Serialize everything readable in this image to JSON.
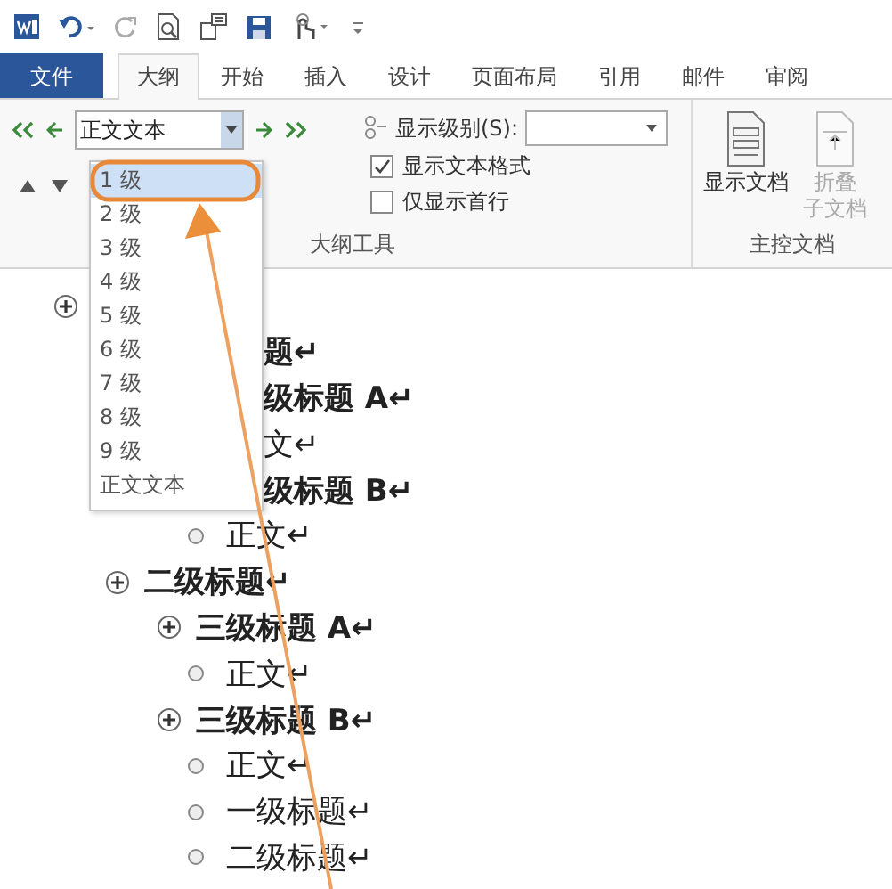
{
  "tabs": [
    {
      "label": "文件",
      "kind": "file",
      "selected": false
    },
    {
      "label": "大纲",
      "kind": "tab",
      "selected": true
    },
    {
      "label": "开始",
      "kind": "tab",
      "selected": false
    },
    {
      "label": "插入",
      "kind": "tab",
      "selected": false
    },
    {
      "label": "设计",
      "kind": "tab",
      "selected": false
    },
    {
      "label": "页面布局",
      "kind": "tab",
      "selected": false
    },
    {
      "label": "引用",
      "kind": "tab",
      "selected": false
    },
    {
      "label": "邮件",
      "kind": "tab",
      "selected": false
    },
    {
      "label": "审阅",
      "kind": "tab",
      "selected": false
    }
  ],
  "outline_tools": {
    "level_combo": {
      "value": "正文文本"
    },
    "show_level": {
      "label": "显示级别(S):"
    },
    "checkboxes": [
      {
        "label": "显示文本格式",
        "checked": true
      },
      {
        "label": "仅显示首行",
        "checked": false
      }
    ],
    "group_label": "大纲工具"
  },
  "master_document": {
    "buttons": [
      {
        "lines": [
          "显示文档"
        ],
        "disabled": false
      },
      {
        "lines": [
          "折叠",
          "子文档"
        ],
        "disabled": true
      }
    ],
    "group_label": "主控文档"
  },
  "level_dropdown": [
    {
      "label": "1 级",
      "selected": true
    },
    {
      "label": "2 级",
      "selected": false
    },
    {
      "label": "3 级",
      "selected": false
    },
    {
      "label": "4 级",
      "selected": false
    },
    {
      "label": "5 级",
      "selected": false
    },
    {
      "label": "6 级",
      "selected": false
    },
    {
      "label": "7 级",
      "selected": false
    },
    {
      "label": "8 级",
      "selected": false
    },
    {
      "label": "9 级",
      "selected": false
    },
    {
      "label": "正文文本",
      "selected": false
    }
  ],
  "document": [
    {
      "kind": "heading",
      "covered": false,
      "children": [
        {
          "kind": "heading",
          "covered": true,
          "text": "题↵",
          "children": [
            {
              "kind": "heading",
              "covered": true,
              "text": "级标题 A↵",
              "children": [
                {
                  "kind": "body",
                  "covered": true,
                  "text": "文↵"
                }
              ]
            },
            {
              "kind": "heading",
              "covered": true,
              "text": "级标题 B↵",
              "children": [
                {
                  "kind": "body",
                  "covered": false,
                  "text": "正文↵"
                }
              ]
            }
          ]
        },
        {
          "kind": "heading",
          "covered": false,
          "text": "二级标题↵",
          "children": [
            {
              "kind": "heading",
              "covered": false,
              "text": "三级标题 A↵",
              "children": [
                {
                  "kind": "body",
                  "covered": false,
                  "text": "正文↵"
                }
              ]
            },
            {
              "kind": "heading",
              "covered": false,
              "text": "三级标题 B↵",
              "children": [
                {
                  "kind": "body",
                  "covered": false,
                  "text": "正文↵"
                },
                {
                  "kind": "body",
                  "covered": false,
                  "text": "一级标题↵"
                },
                {
                  "kind": "body",
                  "covered": false,
                  "text": "二级标题↵"
                }
              ]
            }
          ]
        }
      ]
    }
  ]
}
